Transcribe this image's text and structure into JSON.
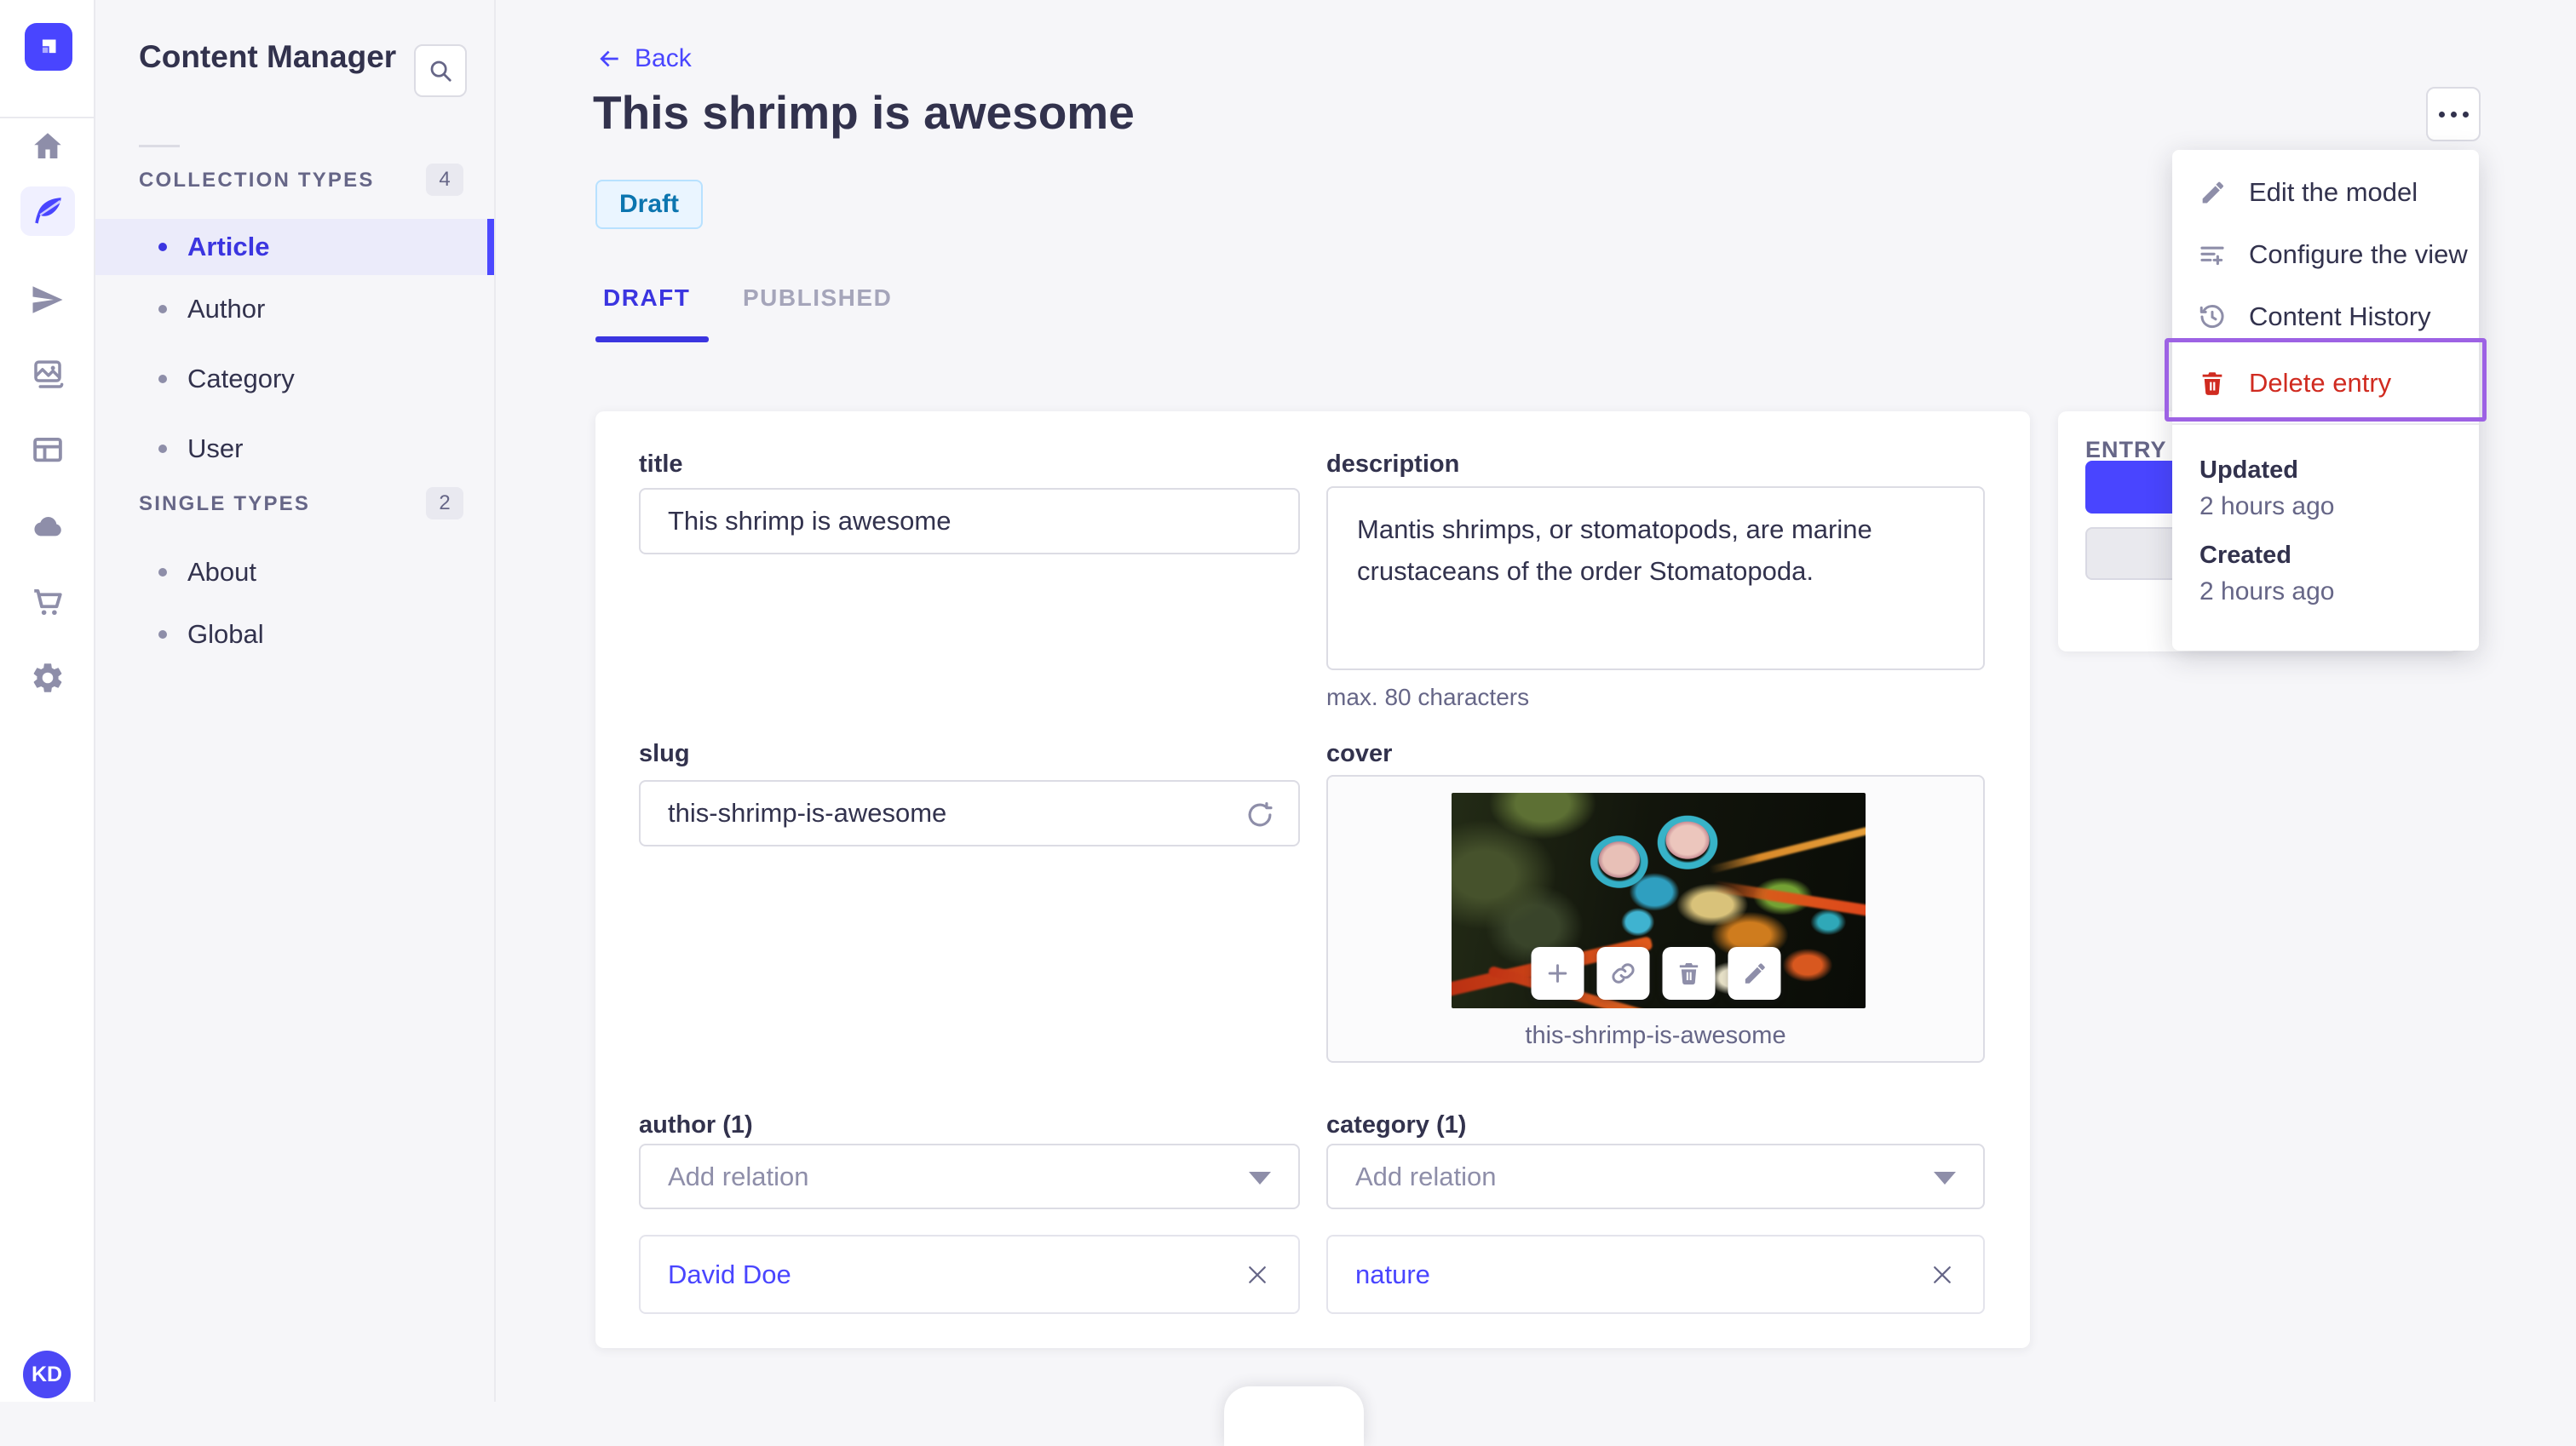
{
  "app": {
    "avatar_initials": "KD",
    "icons": [
      "strapi-logo-icon",
      "home-icon",
      "content-manager-icon",
      "releases-icon",
      "media-library-icon",
      "content-type-builder-icon",
      "deploy-cloud-icon",
      "marketplace-icon",
      "settings-icon",
      "search-icon",
      "back-arrow-icon",
      "more-icon",
      "regenerate-icon",
      "add-icon",
      "link-icon",
      "trash-icon",
      "pencil-icon",
      "clock-history-icon",
      "configure-list-icon",
      "chevron-down-icon",
      "close-icon"
    ]
  },
  "subnav": {
    "title": "Content Manager",
    "sections": [
      {
        "label": "COLLECTION TYPES",
        "count": "4",
        "items": [
          {
            "label": "Article"
          },
          {
            "label": "Author"
          },
          {
            "label": "Category"
          },
          {
            "label": "User"
          }
        ]
      },
      {
        "label": "SINGLE TYPES",
        "count": "2",
        "items": [
          {
            "label": "About"
          },
          {
            "label": "Global"
          }
        ]
      }
    ]
  },
  "header": {
    "back_label": "Back",
    "title": "This shrimp is awesome",
    "status_badge": "Draft",
    "tabs": [
      {
        "label": "DRAFT"
      },
      {
        "label": "PUBLISHED"
      }
    ]
  },
  "form": {
    "title": {
      "label": "title",
      "value": "This shrimp is awesome"
    },
    "description": {
      "label": "description",
      "value": "Mantis shrimps, or stomatopods, are marine crustaceans of the order Stomatopoda.",
      "hint": "max. 80 characters"
    },
    "slug": {
      "label": "slug",
      "value": "this-shrimp-is-awesome"
    },
    "cover": {
      "label": "cover",
      "caption": "this-shrimp-is-awesome"
    },
    "author": {
      "label": "author (1)",
      "placeholder": "Add relation",
      "relation": "David Doe"
    },
    "category": {
      "label": "category (1)",
      "placeholder": "Add relation",
      "relation": "nature"
    }
  },
  "entry_panel": {
    "title": "ENTRY"
  },
  "context_menu": {
    "items": [
      {
        "label": "Edit the model"
      },
      {
        "label": "Configure the view"
      },
      {
        "label": "Content History"
      },
      {
        "label": "Delete entry"
      }
    ],
    "meta": [
      {
        "label": "Updated",
        "value": "2 hours ago"
      },
      {
        "label": "Created",
        "value": "2 hours ago"
      }
    ]
  },
  "colors": {
    "accent": "#4945ff",
    "accent_dark": "#3b35e0",
    "danger": "#d02b20",
    "annotation": "#9d62e4",
    "draft_bg": "#eaf5ff",
    "draft_border": "#b8e1ff",
    "draft_text": "#0c75af"
  }
}
